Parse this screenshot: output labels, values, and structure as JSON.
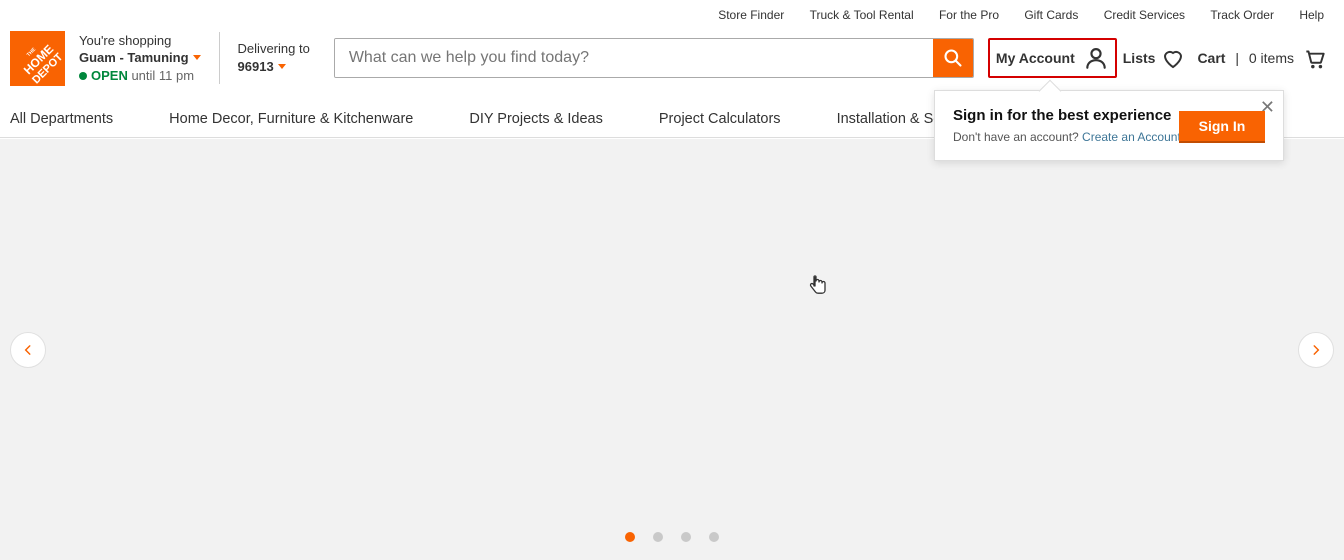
{
  "topLinks": [
    "Store Finder",
    "Truck & Tool Rental",
    "For the Pro",
    "Gift Cards",
    "Credit Services",
    "Track Order",
    "Help"
  ],
  "store": {
    "label": "You're shopping",
    "name": "Guam - Tamuning",
    "statusOpen": "OPEN",
    "statusUntil": " until 11 pm"
  },
  "deliver": {
    "label": "Delivering to",
    "zip": "96913"
  },
  "search": {
    "placeholder": "What can we help you find today?"
  },
  "account": {
    "myAccount": "My Account",
    "lists": "Lists",
    "cart": "Cart",
    "cartCount": "0 items"
  },
  "nav": [
    "All Departments",
    "Home Decor, Furniture & Kitchenware",
    "DIY Projects & Ideas",
    "Project Calculators",
    "Installation & Services"
  ],
  "signinPop": {
    "title": "Sign in for the best experience",
    "subPrefix": "Don't have an account? ",
    "createLink": "Create an Account",
    "btn": "Sign In"
  }
}
